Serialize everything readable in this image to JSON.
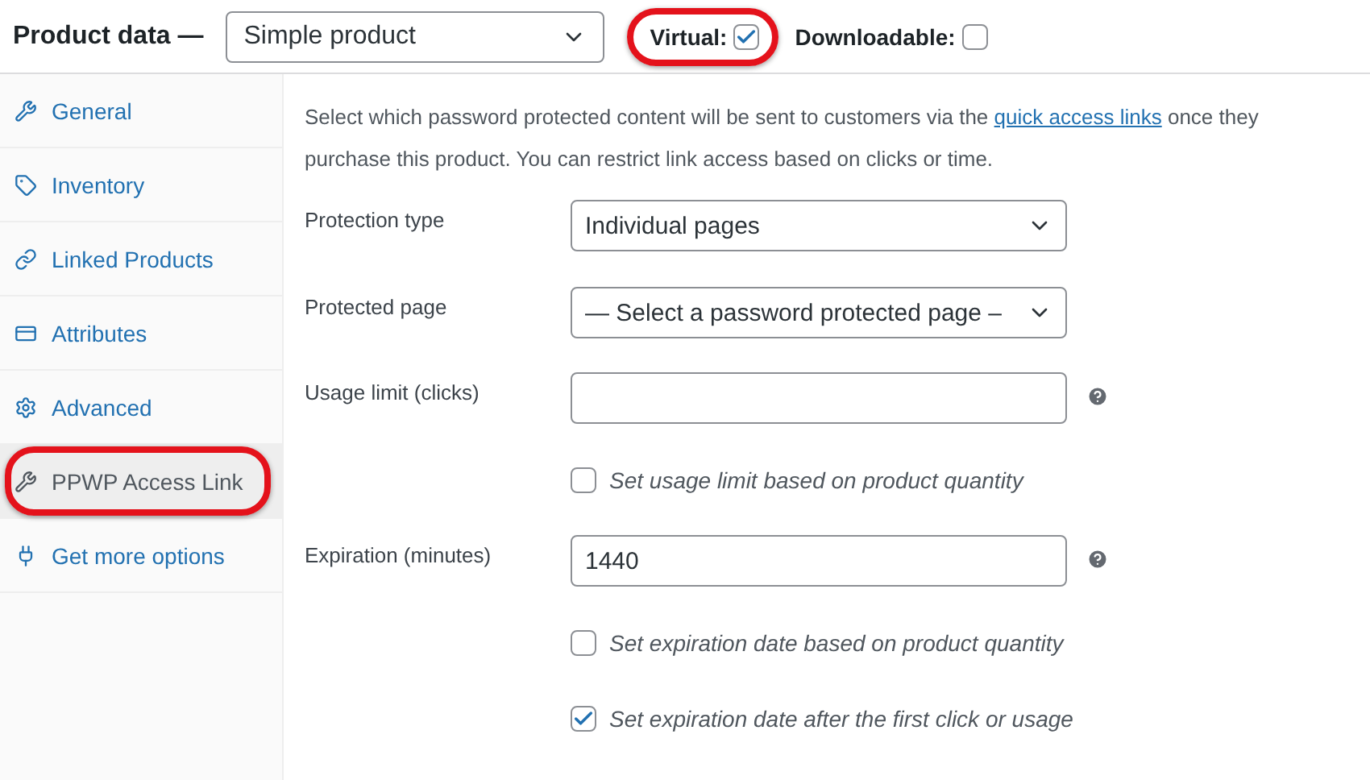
{
  "header": {
    "title": "Product data —",
    "product_type": "Simple product",
    "options": [
      {
        "label": "Virtual:",
        "checked": true,
        "annotated": true
      },
      {
        "label": "Downloadable:",
        "checked": false,
        "annotated": false
      }
    ]
  },
  "tabs": [
    {
      "label": "General",
      "selected": false,
      "annotated": false
    },
    {
      "label": "Inventory",
      "selected": false,
      "annotated": false
    },
    {
      "label": "Linked Products",
      "selected": false,
      "annotated": false
    },
    {
      "label": "Attributes",
      "selected": false,
      "annotated": false
    },
    {
      "label": "Advanced",
      "selected": false,
      "annotated": false
    },
    {
      "label": "PPWP Access Link",
      "selected": true,
      "annotated": true
    },
    {
      "label": "Get more options",
      "selected": false,
      "annotated": false
    }
  ],
  "panel": {
    "intro_before": "Select which password protected content will be sent to customers via the",
    "intro_link": "quick access links",
    "intro_after": "once they purchase this product. You can restrict link access based on clicks or time.",
    "fields": [
      {
        "kind": "select",
        "label": "Protection type",
        "value": "Individual pages",
        "help": false
      },
      {
        "kind": "select",
        "label": "Protected page",
        "value": "— Select a password protected page –",
        "help": false
      },
      {
        "kind": "input",
        "label": "Usage limit (clicks)",
        "help": true
      },
      {
        "kind": "checkbox",
        "label": "Set usage limit based on product quantity",
        "checked": false
      },
      {
        "kind": "input",
        "label": "Expiration (minutes)",
        "value": "1440",
        "help": true
      },
      {
        "kind": "checkbox",
        "label": "Set expiration date based on product quantity",
        "checked": false
      },
      {
        "kind": "checkbox",
        "label": "Set expiration date after the first click or usage",
        "checked": true
      }
    ]
  }
}
